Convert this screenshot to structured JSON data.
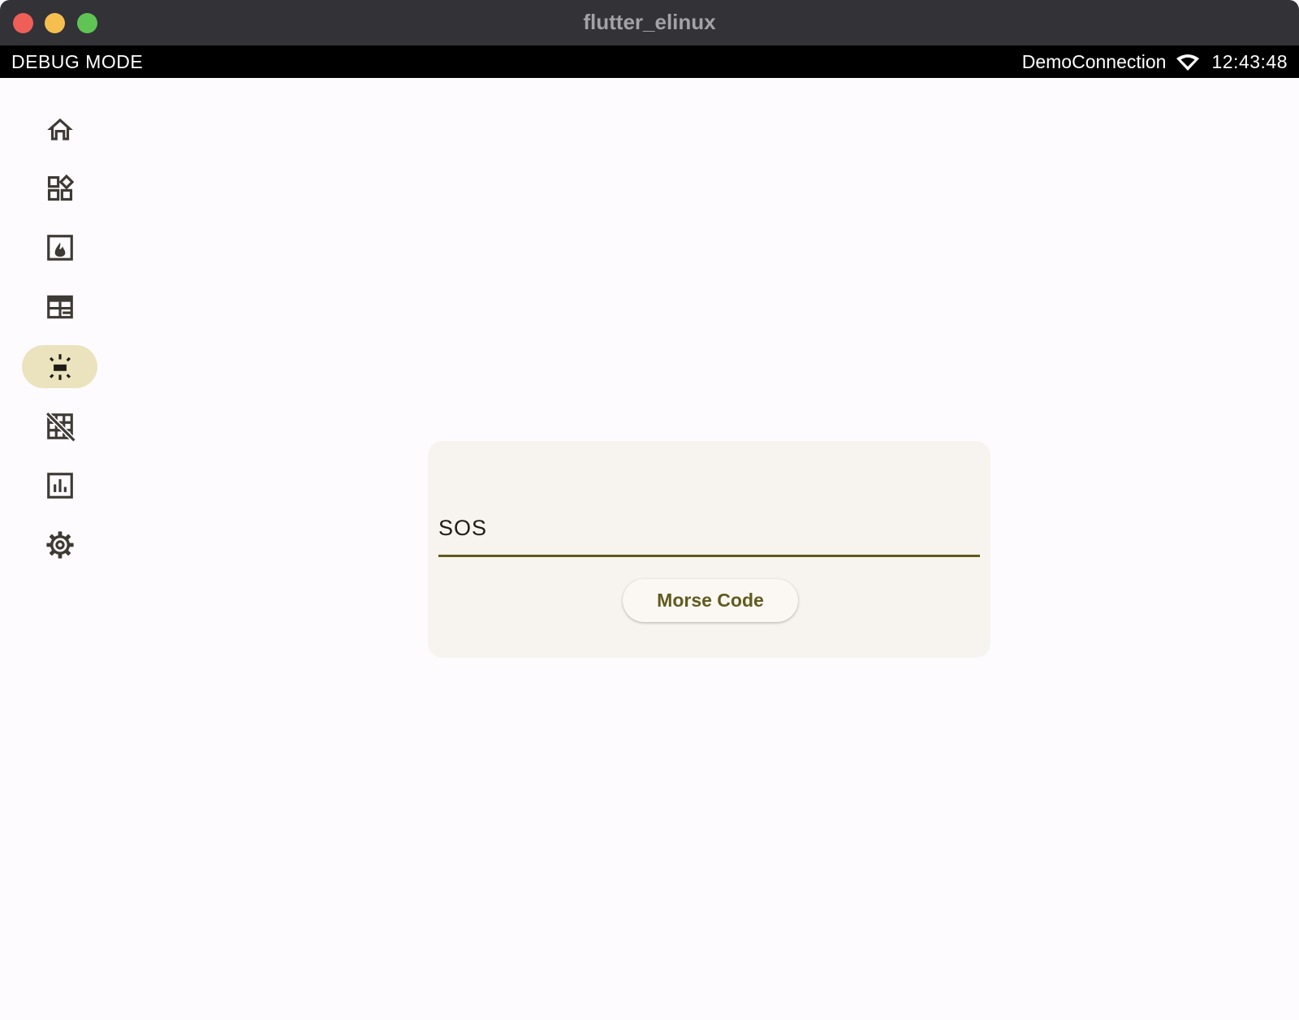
{
  "window": {
    "title": "flutter_elinux"
  },
  "debug_bar": {
    "mode_label": "DEBUG MODE",
    "network_name": "DemoConnection",
    "time": "12:43:48"
  },
  "nav_rail": {
    "items": [
      {
        "id": "home",
        "icon": "home-icon"
      },
      {
        "id": "widgets",
        "icon": "widgets-icon"
      },
      {
        "id": "fireplace",
        "icon": "fireplace-icon"
      },
      {
        "id": "table",
        "icon": "table-chart-icon"
      },
      {
        "id": "highlight",
        "icon": "highlight-icon",
        "selected": true
      },
      {
        "id": "grid-off",
        "icon": "grid-off-icon"
      },
      {
        "id": "chart",
        "icon": "bar-chart-icon"
      },
      {
        "id": "settings",
        "icon": "settings-icon"
      }
    ]
  },
  "morse_card": {
    "input_value": "SOS",
    "button_label": "Morse Code"
  },
  "colors": {
    "accent": "#615a1d",
    "selected_pill": "#ebe3bd",
    "card_background": "#f7f3ee",
    "page_background": "#fefbff"
  }
}
